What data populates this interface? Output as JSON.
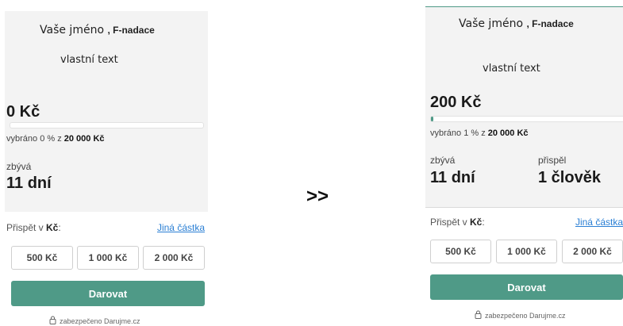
{
  "before": {
    "name": "Vaše jméno",
    "org": ", F-nadace",
    "custom_text": "vlastní text",
    "amount": "0 Kč",
    "progress_fraction": 0.0,
    "raised_prefix": "vybráno 0 % z ",
    "goal": "20 000 Kč",
    "remaining_label": "zbývá",
    "remaining_value": "11 dní",
    "contribute_prefix": "Přispět v ",
    "currency": "Kč",
    "contribute_suffix": ":",
    "other_amount": "Jiná částka",
    "amounts": [
      "500 Kč",
      "1 000 Kč",
      "2 000 Kč"
    ],
    "donate_label": "Darovat",
    "secure_text": "zabezpečeno Darujme.cz"
  },
  "arrow": ">>",
  "after": {
    "name": "Vaše jméno",
    "org": ", F-nadace",
    "custom_text": "vlastní text",
    "amount": "200 Kč",
    "progress_fraction": 0.01,
    "raised_prefix": "vybráno 1 % z ",
    "goal": "20 000 Kč",
    "remaining_label": "zbývá",
    "remaining_value": "11 dní",
    "donors_label": "přispěl",
    "donors_value": "1 člověk",
    "contribute_prefix": "Přispět v ",
    "currency": "Kč",
    "contribute_suffix": ":",
    "other_amount": "Jiná částka",
    "amounts": [
      "500 Kč",
      "1 000 Kč",
      "2 000 Kč"
    ],
    "donate_label": "Darovat",
    "secure_text": "zabezpečeno Darujme.cz"
  },
  "colors": {
    "accent": "#4f9a87",
    "link": "#2a7fd4",
    "card_bg": "#f3f3f3"
  },
  "icons": {
    "secure": "lock-icon"
  }
}
